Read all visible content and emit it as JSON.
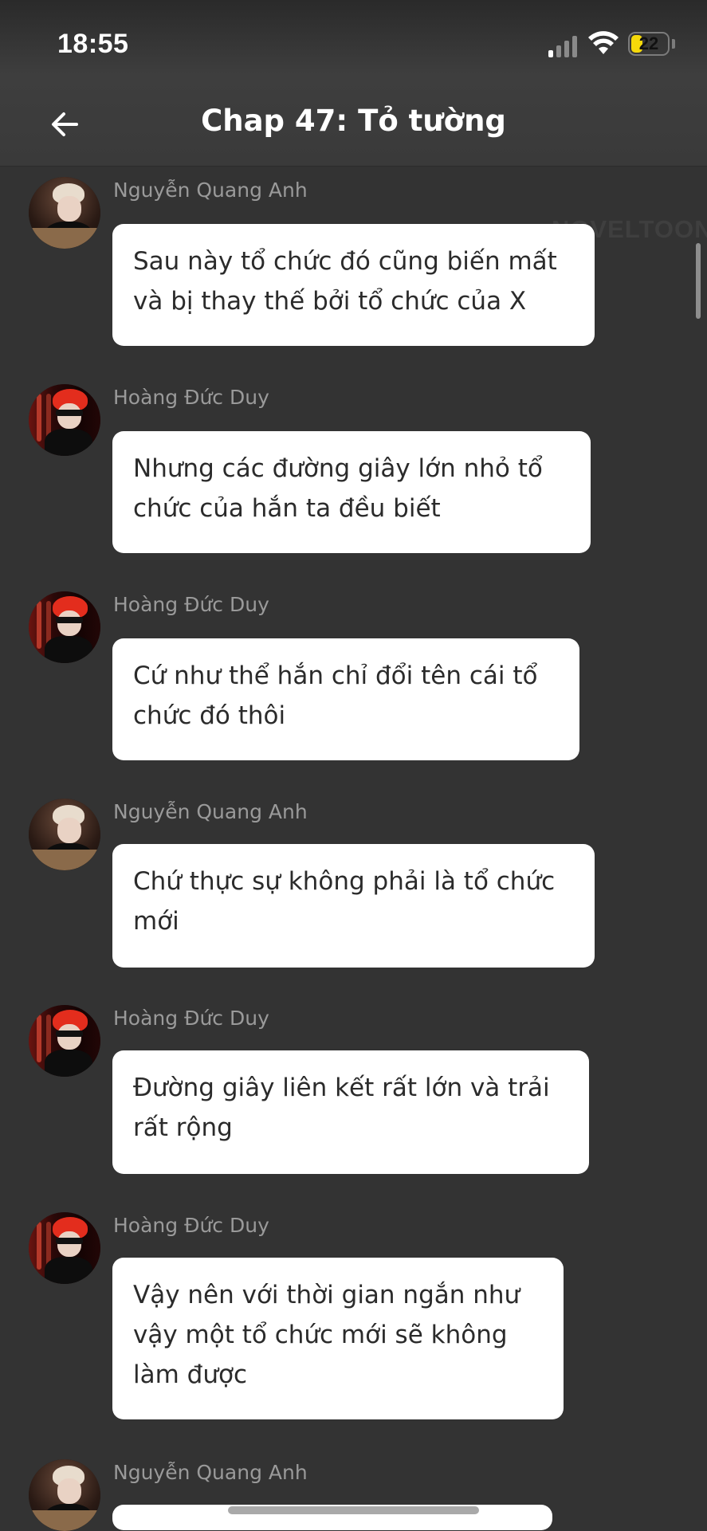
{
  "status_bar": {
    "time": "18:55",
    "battery_level": "22"
  },
  "header": {
    "title": "Chap 47: Tỏ tường",
    "back_icon": "arrow-left-icon"
  },
  "watermark": "NOVELTOON",
  "messages": [
    {
      "sender": "Nguyễn Quang Anh",
      "avatar": "nqa",
      "text": "Sau này tổ chức đó cũng biến mất và bị thay thế bởi tổ chức của X"
    },
    {
      "sender": "Hoàng Đức Duy",
      "avatar": "hdd",
      "text": "Nhưng các đường giây lớn nhỏ tổ chức của hắn ta đều biết"
    },
    {
      "sender": "Hoàng Đức Duy",
      "avatar": "hdd",
      "text": "Cứ như thể hắn chỉ đổi tên cái tổ chức đó thôi"
    },
    {
      "sender": "Nguyễn Quang Anh",
      "avatar": "nqa",
      "text": "Chứ thực sự không phải là tổ chức mới"
    },
    {
      "sender": "Hoàng Đức Duy",
      "avatar": "hdd",
      "text": "Đường giây liên kết rất lớn và trải rất rộng"
    },
    {
      "sender": "Hoàng Đức Duy",
      "avatar": "hdd",
      "text": "Vậy nên với thời gian ngắn như vậy một tổ chức mới sẽ không làm được"
    },
    {
      "sender": "Nguyễn Quang Anh",
      "avatar": "nqa",
      "text": ""
    }
  ]
}
